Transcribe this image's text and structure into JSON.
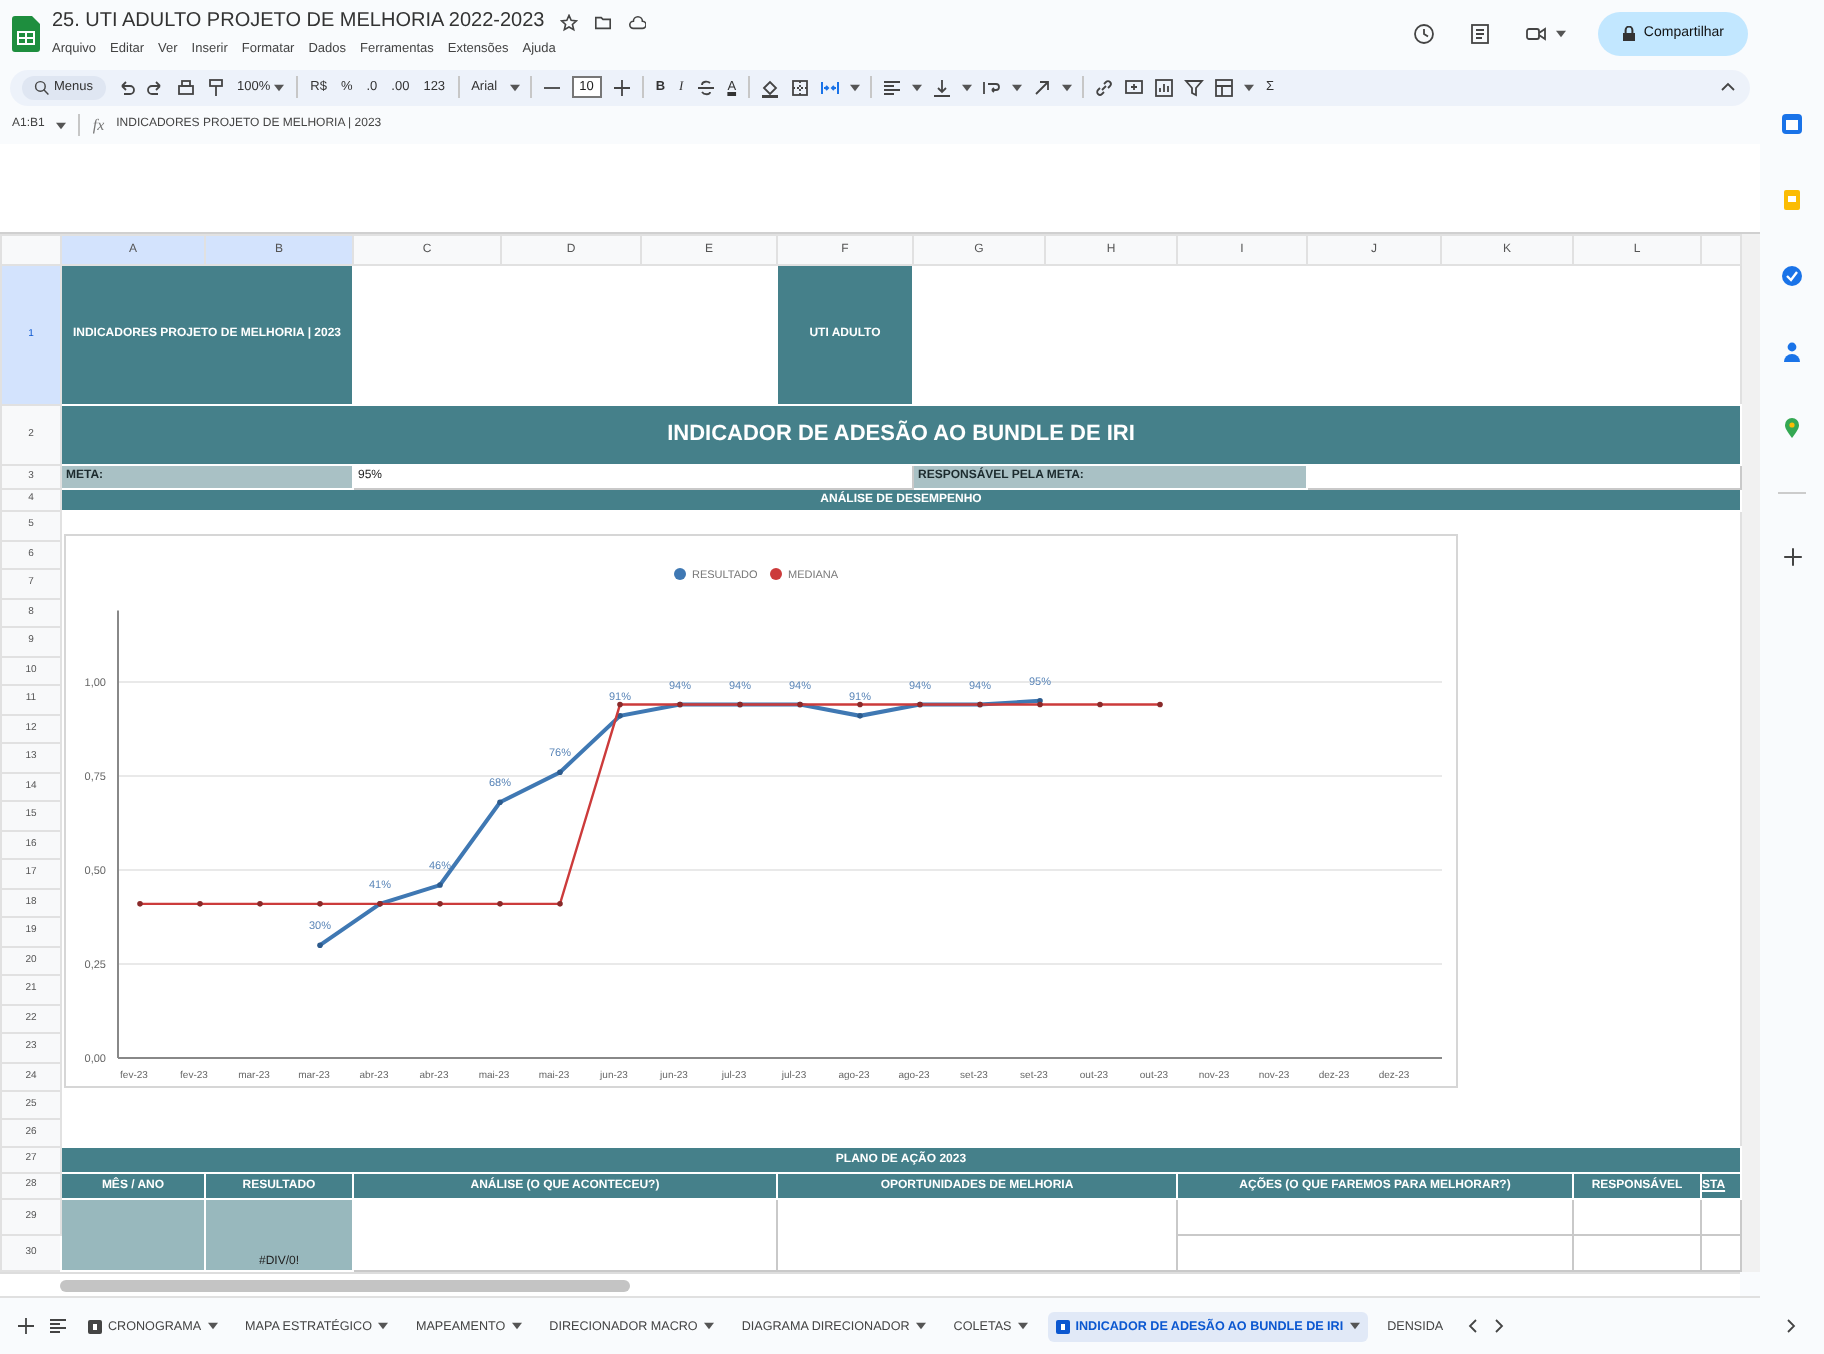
{
  "document": {
    "title": "25. UTI ADULTO PROJETO DE MELHORIA 2022-2023",
    "menus": [
      "Arquivo",
      "Editar",
      "Ver",
      "Inserir",
      "Formatar",
      "Dados",
      "Ferramentas",
      "Extensões",
      "Ajuda"
    ],
    "share_button": "Compartilhar"
  },
  "toolbar": {
    "search": "Menus",
    "zoom": "100%",
    "currency": "R$",
    "percent": "%",
    "decimal_decrease": ".0",
    "decimal_increase": ".00",
    "number_format": "123",
    "font": "Arial",
    "font_size": "10",
    "bold": "B",
    "italic": "I",
    "text_color": "A",
    "sum": "Σ"
  },
  "formula_bar": {
    "cell_reference": "A1:B1",
    "fx": "fx",
    "content": "INDICADORES PROJETO DE MELHORIA | 2023"
  },
  "columns": [
    {
      "label": "A",
      "selected": true
    },
    {
      "label": "B",
      "selected": true
    },
    {
      "label": "C",
      "selected": false
    },
    {
      "label": "D",
      "selected": false
    },
    {
      "label": "E",
      "selected": false
    },
    {
      "label": "F",
      "selected": false
    },
    {
      "label": "G",
      "selected": false
    },
    {
      "label": "H",
      "selected": false
    },
    {
      "label": "I",
      "selected": false
    },
    {
      "label": "J",
      "selected": false
    },
    {
      "label": "K",
      "selected": false
    },
    {
      "label": "L",
      "selected": false
    }
  ],
  "rows": [
    {
      "label": "1",
      "selected": true
    },
    {
      "label": "2",
      "selected": false
    },
    {
      "label": "3",
      "selected": false
    },
    {
      "label": "4",
      "selected": false
    },
    {
      "label": "5",
      "selected": false
    },
    {
      "label": "6",
      "selected": false
    },
    {
      "label": "7",
      "selected": false
    },
    {
      "label": "8",
      "selected": false
    },
    {
      "label": "9",
      "selected": false
    },
    {
      "label": "10",
      "selected": false
    },
    {
      "label": "11",
      "selected": false
    },
    {
      "label": "12",
      "selected": false
    },
    {
      "label": "13",
      "selected": false
    },
    {
      "label": "14",
      "selected": false
    },
    {
      "label": "15",
      "selected": false
    },
    {
      "label": "16",
      "selected": false
    },
    {
      "label": "17",
      "selected": false
    },
    {
      "label": "18",
      "selected": false
    },
    {
      "label": "19",
      "selected": false
    },
    {
      "label": "20",
      "selected": false
    },
    {
      "label": "21",
      "selected": false
    },
    {
      "label": "22",
      "selected": false
    },
    {
      "label": "23",
      "selected": false
    },
    {
      "label": "24",
      "selected": false
    },
    {
      "label": "25",
      "selected": false
    },
    {
      "label": "26",
      "selected": false
    },
    {
      "label": "27",
      "selected": false
    },
    {
      "label": "28",
      "selected": false
    },
    {
      "label": "29",
      "selected": false
    },
    {
      "label": "30",
      "selected": false
    }
  ],
  "sheet": {
    "project_label": "INDICADORES PROJETO DE MELHORIA | 2023",
    "unit": "UTI ADULTO",
    "title": "INDICADOR DE ADESÃO AO BUNDLE DE IRI",
    "meta_label": "META:",
    "meta_value": "95%",
    "owner_label": "RESPONSÁVEL PELA META:",
    "section_title": "ANÁLISE DE DESEMPENHO"
  },
  "chart": {
    "chart_data": {
      "type": "line",
      "categories": [
        "fev-23",
        "fev-23",
        "mar-23",
        "mar-23",
        "abr-23",
        "abr-23",
        "mai-23",
        "mai-23",
        "jun-23",
        "jun-23",
        "jul-23",
        "jul-23",
        "ago-23",
        "ago-23",
        "set-23",
        "set-23",
        "out-23",
        "out-23",
        "nov-23",
        "nov-23",
        "dez-23",
        "dez-23"
      ],
      "series": [
        {
          "name": "RESULTADO",
          "color": "#3f78b3",
          "values": [
            null,
            null,
            null,
            0.3,
            0.41,
            0.46,
            0.68,
            0.76,
            0.91,
            0.94,
            0.94,
            0.94,
            0.91,
            0.94,
            0.94,
            0.95,
            null,
            null,
            null,
            null,
            null,
            null
          ]
        },
        {
          "name": "MEDIANA",
          "color": "#cc3b3b",
          "values": [
            0.41,
            0.41,
            0.41,
            0.41,
            0.41,
            0.41,
            0.41,
            0.41,
            0.94,
            0.94,
            0.94,
            0.94,
            0.94,
            0.94,
            0.94,
            0.94,
            0.94,
            0.94,
            null,
            null,
            null,
            null
          ]
        }
      ],
      "grid": true,
      "legend": "top",
      "ylim": [
        0,
        1.19
      ],
      "yticks": [
        {
          "value": 0,
          "label": "0,00"
        },
        {
          "value": 0.25,
          "label": "0,25"
        },
        {
          "value": 0.5,
          "label": "0,50"
        },
        {
          "value": 0.75,
          "label": "0,75"
        },
        {
          "value": 1,
          "label": "1,00"
        }
      ],
      "value_labels": [
        null,
        null,
        null,
        "30%",
        "41%",
        "46%",
        "68%",
        "76%",
        "91%",
        "94%",
        "94%",
        "94%",
        "91%",
        "94%",
        "94%",
        "95%",
        null,
        null,
        null,
        null,
        null,
        null
      ]
    }
  },
  "action_plan": {
    "title": "PLANO DE AÇÃO 2023",
    "columns": [
      "MÊS / ANO",
      "RESULTADO",
      "ANÁLISE (O QUE ACONTECEU?)",
      "OPORTUNIDADES DE MELHORIA",
      "AÇÕES (O QUE FAREMOS PARA MELHORAR?)",
      "RESPONSÁVEL",
      "STA"
    ],
    "result": "#DIV/0!"
  },
  "sheet_tabs": [
    {
      "label": "CRONOGRAMA",
      "kind": "icon",
      "selected": false
    },
    {
      "label": "MAPA ESTRATÉGICO",
      "kind": "plain",
      "selected": false
    },
    {
      "label": "MAPEAMENTO",
      "kind": "plain",
      "selected": false
    },
    {
      "label": "DIRECIONADOR MACRO",
      "kind": "plain",
      "selected": false
    },
    {
      "label": "DIAGRAMA DIRECIONADOR",
      "kind": "plain",
      "selected": false
    },
    {
      "label": "COLETAS",
      "kind": "plain",
      "selected": false
    },
    {
      "label": "INDICADOR DE ADESÃO AO BUNDLE DE IRI",
      "kind": "icon",
      "selected": true
    },
    {
      "label": "DENSIDA",
      "kind": "cut",
      "selected": false
    }
  ]
}
